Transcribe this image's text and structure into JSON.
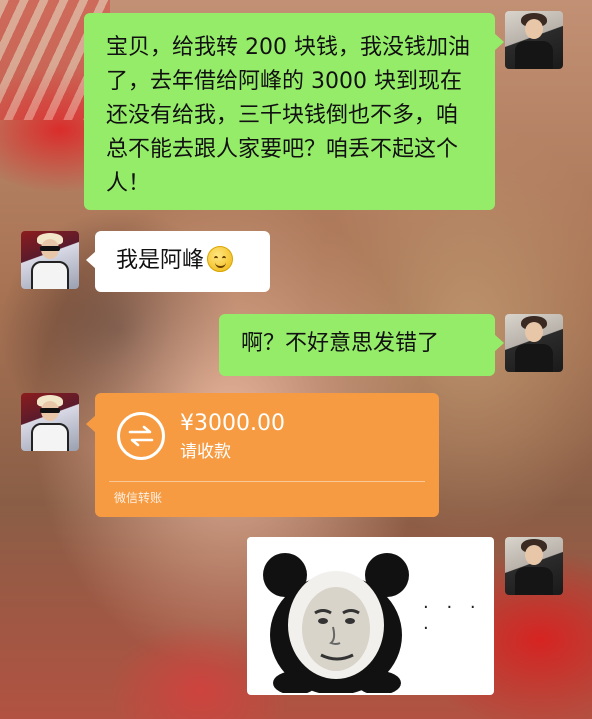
{
  "chat": {
    "messages": [
      {
        "sender": "self",
        "type": "text",
        "text": "宝贝，给我转 200 块钱，我没钱加油了，去年借给阿峰的 3000 块到现在还没有给我，三千块钱倒也不多，咱总不能去跟人家要吧？咱丢不起这个人！"
      },
      {
        "sender": "feng",
        "type": "text",
        "text": "我是阿峰",
        "emoji": "smiley-icon"
      },
      {
        "sender": "self",
        "type": "text",
        "text": "啊？不好意思发错了"
      },
      {
        "sender": "feng",
        "type": "transfer",
        "amount": "¥3000.00",
        "status": "请收款",
        "provider": "微信转账"
      },
      {
        "sender": "self",
        "type": "sticker",
        "sticker": "panda-face-sticker",
        "text": "· · · ·"
      }
    ]
  },
  "colors": {
    "self_bubble": "#95ec69",
    "other_bubble": "#ffffff",
    "transfer_card": "#f69b41"
  }
}
